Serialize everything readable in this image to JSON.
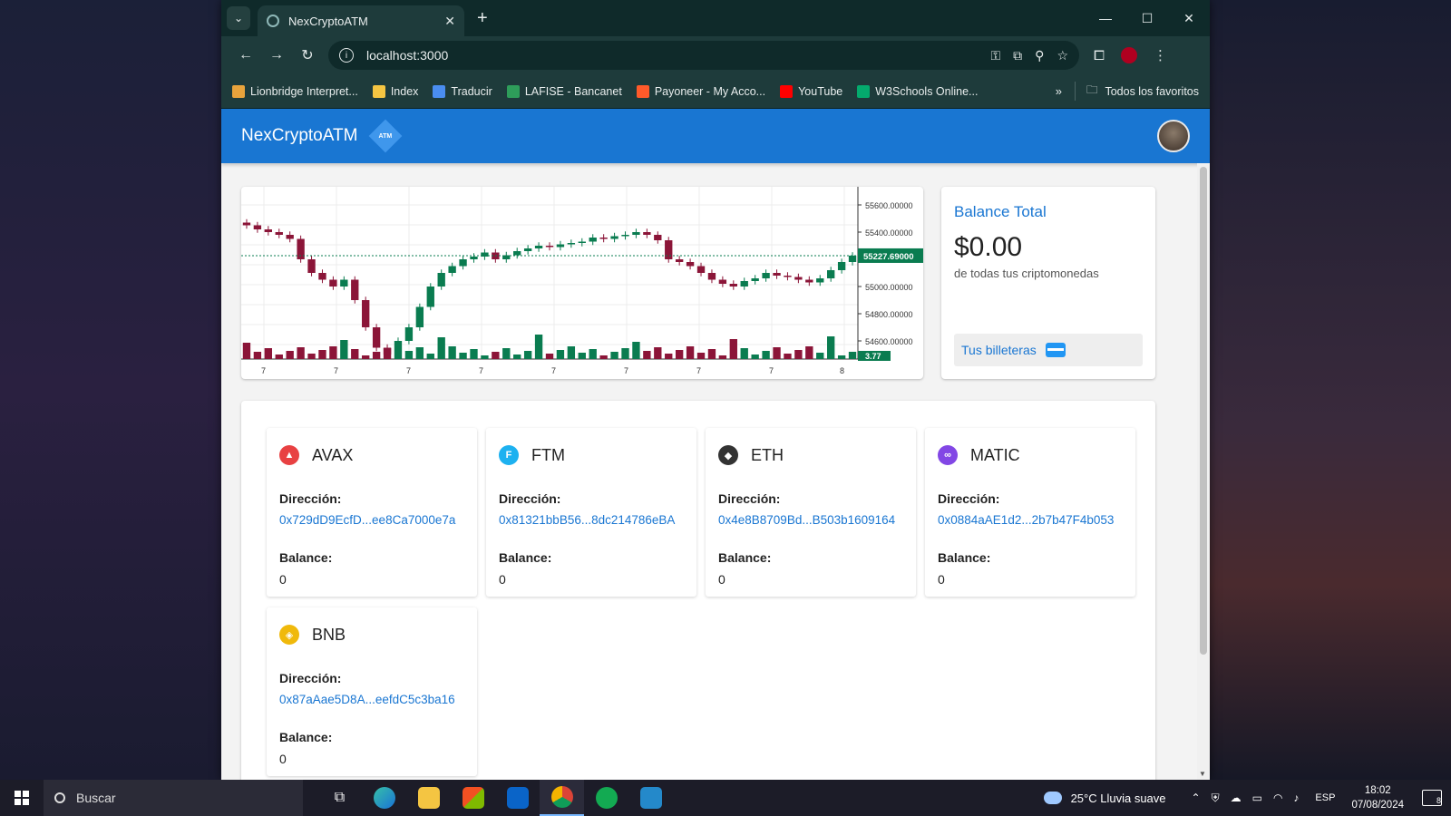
{
  "browser": {
    "tab_title": "NexCryptoATM",
    "tab_close": "✕",
    "new_tab": "+",
    "url": "localhost:3000",
    "bookmarks": [
      {
        "label": "Lionbridge Interpret...",
        "color": "#e8a33c"
      },
      {
        "label": "Index",
        "color": "#f5c542"
      },
      {
        "label": "Traducir",
        "color": "#4a8df0"
      },
      {
        "label": "LAFISE - Bancanet",
        "color": "#2e9d5a"
      },
      {
        "label": "Payoneer - My Acco...",
        "color": "#ff5a2a"
      },
      {
        "label": "YouTube",
        "color": "#ff0000"
      },
      {
        "label": "W3Schools Online...",
        "color": "#04aa6d"
      }
    ],
    "bookmarks_more": "»",
    "all_bookmarks": "Todos los favoritos"
  },
  "app": {
    "brand": "NexCryptoATM",
    "logo_text": "ATM",
    "balance": {
      "title": "Balance Total",
      "amount": "$0.00",
      "subtitle": "de todas tus criptomonedas",
      "wallets_button": "Tus billeteras"
    },
    "wallets": [
      {
        "symbol": "AVAX",
        "address_label": "Dirección:",
        "address": "0x729dD9EcfD...ee8Ca7000e7a",
        "balance_label": "Balance:",
        "balance": "0",
        "color": "#e84142",
        "glyph": "▲"
      },
      {
        "symbol": "FTM",
        "address_label": "Dirección:",
        "address": "0x81321bbB56...8dc214786eBA",
        "balance_label": "Balance:",
        "balance": "0",
        "color": "#1db1f0",
        "glyph": "F"
      },
      {
        "symbol": "ETH",
        "address_label": "Dirección:",
        "address": "0x4e8B8709Bd...B503b1609164",
        "balance_label": "Balance:",
        "balance": "0",
        "color": "#333333",
        "glyph": "◆"
      },
      {
        "symbol": "MATIC",
        "address_label": "Dirección:",
        "address": "0x0884aAE1d2...2b7b47F4b053",
        "balance_label": "Balance:",
        "balance": "0",
        "color": "#8247e5",
        "glyph": "∞"
      },
      {
        "symbol": "BNB",
        "address_label": "Dirección:",
        "address": "0x87aAae5D8A...eefdC5c3ba16",
        "balance_label": "Balance:",
        "balance": "0",
        "color": "#f0b90b",
        "glyph": "◈"
      }
    ]
  },
  "chart_data": {
    "type": "candlestick",
    "y_ticks": [
      "55600.00000",
      "55400.00000",
      "55000.00000",
      "54800.00000",
      "54600.00000"
    ],
    "current_price": "55227.69000",
    "volume_label": "3.77",
    "x_ticks": [
      "7",
      "7",
      "7",
      "7",
      "7",
      "7",
      "7",
      "7",
      "8"
    ],
    "up_color": "#0a7c50",
    "down_color": "#8b1538",
    "ylim": [
      54480,
      55680
    ],
    "close": [
      55450,
      55420,
      55400,
      55380,
      55350,
      55200,
      55100,
      55050,
      55000,
      55050,
      54900,
      54700,
      54550,
      54500,
      54600,
      54700,
      54850,
      55000,
      55100,
      55150,
      55200,
      55220,
      55250,
      55200,
      55230,
      55260,
      55280,
      55300,
      55290,
      55310,
      55320,
      55330,
      55360,
      55350,
      55370,
      55380,
      55400,
      55380,
      55340,
      55200,
      55180,
      55150,
      55100,
      55050,
      55020,
      55000,
      55040,
      55060,
      55100,
      55080,
      55070,
      55050,
      55030,
      55060,
      55120,
      55180,
      55227
    ]
  },
  "taskbar": {
    "search_placeholder": "Buscar",
    "weather": "25°C  Lluvia suave",
    "language": "ESP",
    "time": "18:02",
    "date": "07/08/2024",
    "notifications": "8"
  }
}
